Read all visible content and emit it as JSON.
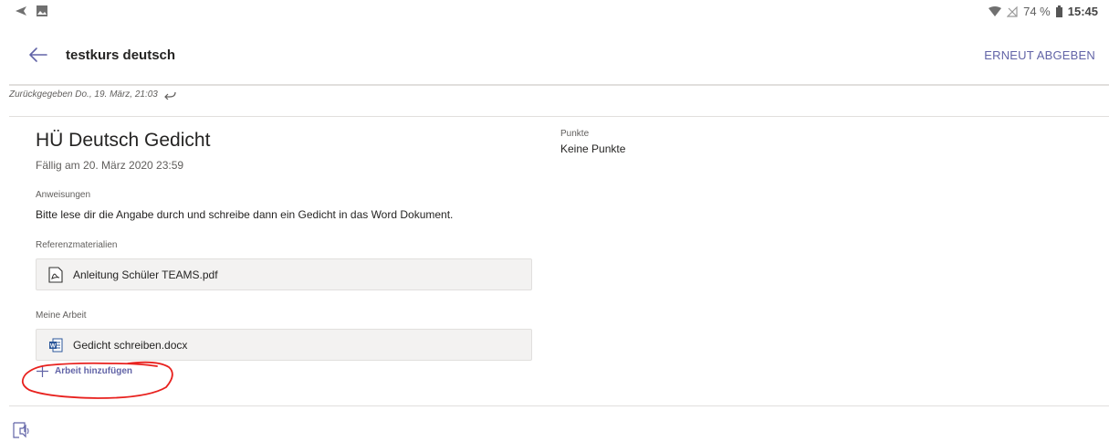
{
  "status_bar": {
    "battery": "74 %",
    "time": "15:45"
  },
  "header": {
    "title": "testkurs deutsch",
    "resubmit_label": "ERNEUT ABGEBEN"
  },
  "returned_note": "Zurückgegeben Do., 19. März, 21:03",
  "assignment": {
    "title": "HÜ Deutsch Gedicht",
    "due": "Fällig am 20. März 2020 23:59",
    "instructions_label": "Anweisungen",
    "instructions": "Bitte lese dir die Angabe durch und schreibe dann ein Gedicht in das Word Dokument.",
    "reference_label": "Referenzmaterialien",
    "reference_file": "Anleitung Schüler TEAMS.pdf",
    "my_work_label": "Meine Arbeit",
    "my_work_file": "Gedicht schreiben.docx",
    "add_work_label": "Arbeit hinzufügen"
  },
  "points": {
    "label": "Punkte",
    "value": "Keine Punkte"
  },
  "colors": {
    "accent": "#6264a7",
    "annotation": "#e8211e",
    "card_bg": "#f3f2f1"
  }
}
